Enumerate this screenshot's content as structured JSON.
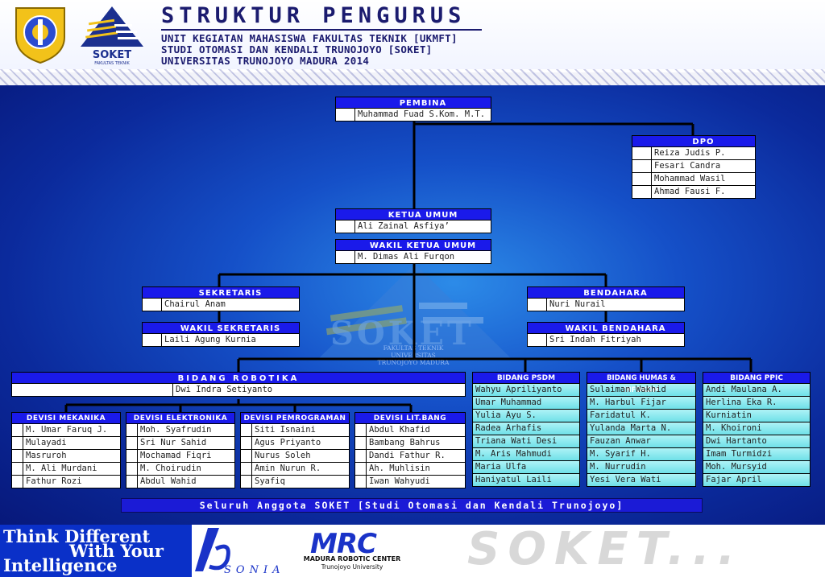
{
  "header": {
    "title": "STRUKTUR PENGURUS",
    "lines": [
      "UNIT KEGIATAN MAHASISWA FAKULTAS TEKNIK [UKMFT]",
      "STUDI OTOMASI DAN KENDALI TRUNOJOYO [SOKET]",
      "UNIVERSITAS TRUNOJOYO MADURA 2014"
    ]
  },
  "watermark": {
    "name": "SOKET",
    "sub": [
      "FAKULTAS TEKNIK",
      "UNIVERSITAS",
      "TRUNOJOYO MADURA"
    ]
  },
  "pembina": {
    "title": "PEMBINA",
    "names": [
      "Muhammad Fuad S.Kom. M.T."
    ]
  },
  "dpo": {
    "title": "DPO",
    "names": [
      "Reiza Judis P.",
      "Fesari Candra",
      "Mohammad Wasil",
      "Ahmad Fausi F."
    ]
  },
  "ketua": {
    "title": "KETUA UMUM",
    "names": [
      "Ali Zainal Asfiya’"
    ]
  },
  "wakil_ketua": {
    "title": "WAKIL KETUA UMUM",
    "names": [
      "M. Dimas Ali Furqon"
    ]
  },
  "sekretaris": {
    "title": "SEKRETARIS",
    "names": [
      "Chairul Anam"
    ]
  },
  "wakil_sekretaris": {
    "title": "WAKIL SEKRETARIS",
    "names": [
      "Laili Agung Kurnia"
    ]
  },
  "bendahara": {
    "title": "BENDAHARA",
    "names": [
      "Nuri Nurail"
    ]
  },
  "wakil_bendahara": {
    "title": "WAKIL BENDAHARA",
    "names": [
      "Sri Indah Fitriyah"
    ]
  },
  "robotika": {
    "title": "BIDANG ROBOTIKA",
    "names": [
      "Dwi Indra Setiyanto"
    ]
  },
  "divisions": [
    {
      "title": "DEVISI MEKANIKA",
      "names": [
        "M. Umar Faruq J.",
        "Mulayadi",
        "Masruroh",
        "M. Ali Murdani",
        "Fathur Rozi"
      ]
    },
    {
      "title": "DEVISI ELEKTRONIKA",
      "names": [
        "Moh. Syafrudin",
        "Sri Nur Sahid",
        "Mochamad Fiqri",
        "M. Choirudin",
        "Abdul Wahid"
      ]
    },
    {
      "title": "DEVISI PEMROGRAMAN",
      "names": [
        "Siti Isnaini",
        "Agus Priyanto",
        "Nurus Soleh",
        "Amin Nurun R.",
        "Syafiq"
      ]
    },
    {
      "title": "DEVISI LIT.BANG",
      "names": [
        "Abdul Khafid",
        "Bambang Bahrus",
        "Dandi Fathur R.",
        "Ah. Muhlisin",
        "Iwan Wahyudi"
      ]
    }
  ],
  "bidang": [
    {
      "title": "BIDANG PSDM",
      "names": [
        "Wahyu Apriliyanto",
        "Umar Muhammad",
        "Yulia Ayu S.",
        "Radea Arhafis",
        "Triana Wati Desi",
        "M. Aris Mahmudi",
        "Maria Ulfa",
        "Haniyatul Laili"
      ]
    },
    {
      "title": "BIDANG HUMAS & INFOKOM",
      "names": [
        "Sulaiman Wakhid",
        "M. Harbul Fijar",
        "Faridatul K.",
        "Yulanda Marta N.",
        "Fauzan Anwar",
        "M. Syarif H.",
        "M. Nurrudin",
        "Yesi Vera Wati"
      ]
    },
    {
      "title": "BIDANG PPIC",
      "names": [
        "Andi Maulana A.",
        "Herlina Eka R.",
        "Kurniatin",
        "M. Khoironi",
        "Dwi Hartanto",
        "Imam Turmidzi",
        "Moh. Mursyid",
        "Fajar April"
      ]
    }
  ],
  "footer_band": "Seluruh Anggota SOKET [Studi Otomasi dan Kendali Trunojoyo]",
  "banner": {
    "think_lines": [
      "Think Different",
      "With Your",
      "Intelligence"
    ],
    "sonia": "SONIA",
    "mrc_title": "MRC",
    "mrc_sub1": "MADURA ROBOTIC CENTER",
    "mrc_sub2": "Trunojoyo University",
    "soket_text": "SOKET..."
  },
  "colors": {
    "title_blue": "#1a1aea",
    "cell_cyan": "#8eeaf0",
    "background": "#1550c8"
  }
}
